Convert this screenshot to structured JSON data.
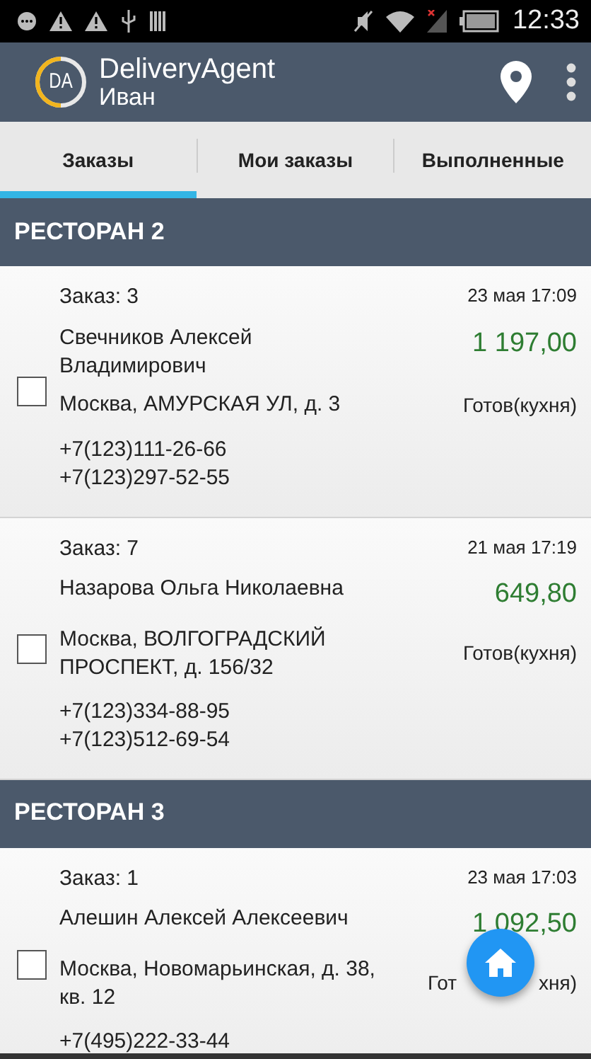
{
  "status_bar": {
    "time": "12:33"
  },
  "app_bar": {
    "logo_text": "DA",
    "title": "DeliveryAgent",
    "subtitle": "Иван"
  },
  "tabs": [
    {
      "label": "Заказы",
      "selected": true
    },
    {
      "label": "Мои заказы",
      "selected": false
    },
    {
      "label": "Выполненные",
      "selected": false
    }
  ],
  "sections": [
    {
      "title": "РЕСТОРАН 2",
      "orders": [
        {
          "number": "Заказ: 3",
          "date": "23 мая 17:09",
          "customer": "Свечников Алексей Владимирович",
          "amount": "1 197,00",
          "address": "Москва, АМУРСКАЯ УЛ, д. 3",
          "status": [
            "Готов(кухня)"
          ],
          "phones": [
            "+7(123)111-26-66",
            "+7(123)297-52-55"
          ],
          "checked": false
        },
        {
          "number": "Заказ: 7",
          "date": "21 мая 17:19",
          "customer": "Назарова Ольга Николаевна",
          "amount": "649,80",
          "address": "Москва, ВОЛГОГРАДСКИЙ ПРОСПЕКТ, д. 156/32",
          "status": [
            "Готов(кухня)"
          ],
          "phones": [
            "+7(123)334-88-95",
            "+7(123)512-69-54"
          ],
          "checked": false
        }
      ]
    },
    {
      "title": "РЕСТОРАН 3",
      "orders": [
        {
          "number": "Заказ: 1",
          "date": "23 мая 17:03",
          "customer": "Алешин Алексей Алексеевич",
          "amount": "1 092,50",
          "address": "Москва, Новомарьинская, д. 38, кв. 12",
          "status": [
            "Гот",
            "хня)"
          ],
          "phones": [
            "+7(495)222-33-44"
          ],
          "checked": false
        }
      ]
    }
  ]
}
